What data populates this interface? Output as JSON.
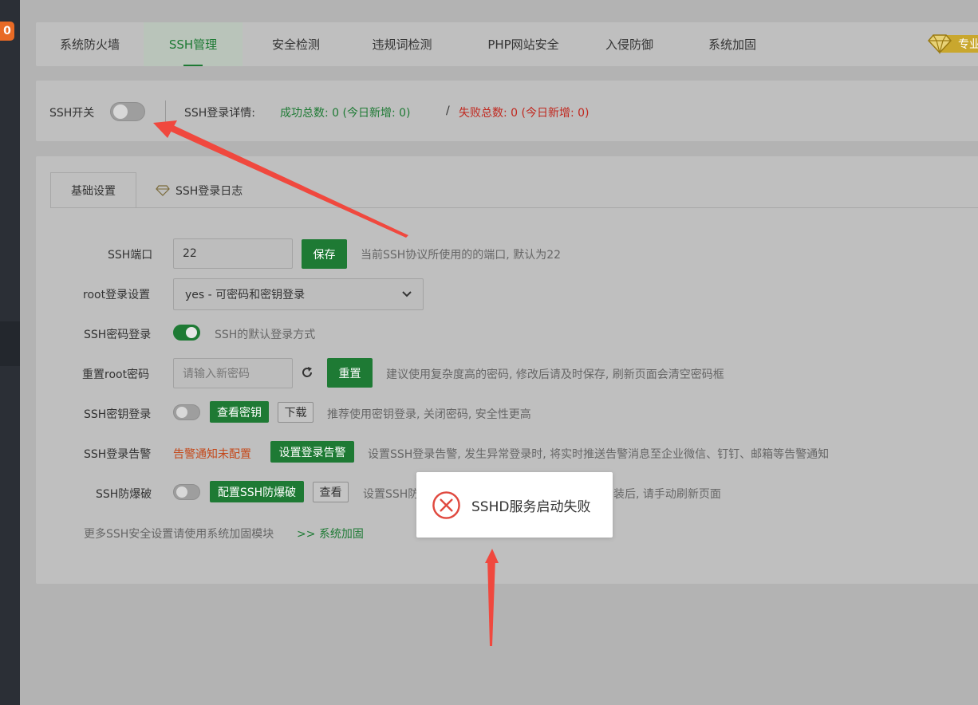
{
  "sidebar": {
    "badge": "0"
  },
  "tabs": [
    {
      "label": "系统防火墙"
    },
    {
      "label": "SSH管理"
    },
    {
      "label": "安全检测"
    },
    {
      "label": "违规词检测"
    },
    {
      "label": "PHP网站安全"
    },
    {
      "label": "入侵防御"
    },
    {
      "label": "系统加固"
    }
  ],
  "pro_label": "专业",
  "status": {
    "switch_label": "SSH开关",
    "details_label": "SSH登录详情:",
    "success": "成功总数: 0 (今日新增: 0)",
    "separator": "/",
    "failure": "失败总数: 0 (今日新增: 0)"
  },
  "inner_tabs": {
    "basic": "基础设置",
    "log": "SSH登录日志"
  },
  "form": {
    "port": {
      "label": "SSH端口",
      "value": "22",
      "save": "保存",
      "hint": "当前SSH协议所使用的的端口, 默认为22"
    },
    "root_login": {
      "label": "root登录设置",
      "selected": "yes - 可密码和密钥登录"
    },
    "password_login": {
      "label": "SSH密码登录",
      "hint": "SSH的默认登录方式"
    },
    "reset_root": {
      "label": "重置root密码",
      "placeholder": "请输入新密码",
      "button": "重置",
      "hint": "建议使用复杂度高的密码, 修改后请及时保存, 刷新页面会清空密码框"
    },
    "key_login": {
      "label": "SSH密钥登录",
      "view": "查看密钥",
      "download": "下载",
      "hint": "推荐使用密钥登录, 关闭密码, 安全性更高"
    },
    "alert": {
      "label": "SSH登录告警",
      "status": "告警通知未配置",
      "button": "设置登录告警",
      "hint": "设置SSH登录告警, 发生异常登录时, 将实时推送告警消息至企业微信、钉钉、邮箱等告警通知"
    },
    "brute": {
      "label": "SSH防爆破",
      "button": "配置SSH防爆破",
      "view": "查看",
      "hint_left": "设置SSH防",
      "hint_right": "装后, 请手动刷新页面"
    },
    "more": {
      "text": "更多SSH安全设置请使用系统加固模块",
      "link": ">> 系统加固"
    }
  },
  "toast": {
    "message": "SSHD服务启动失败"
  },
  "colors": {
    "primary": "#1e7a34",
    "danger": "#c0281f",
    "arrow": "#f0483e"
  }
}
